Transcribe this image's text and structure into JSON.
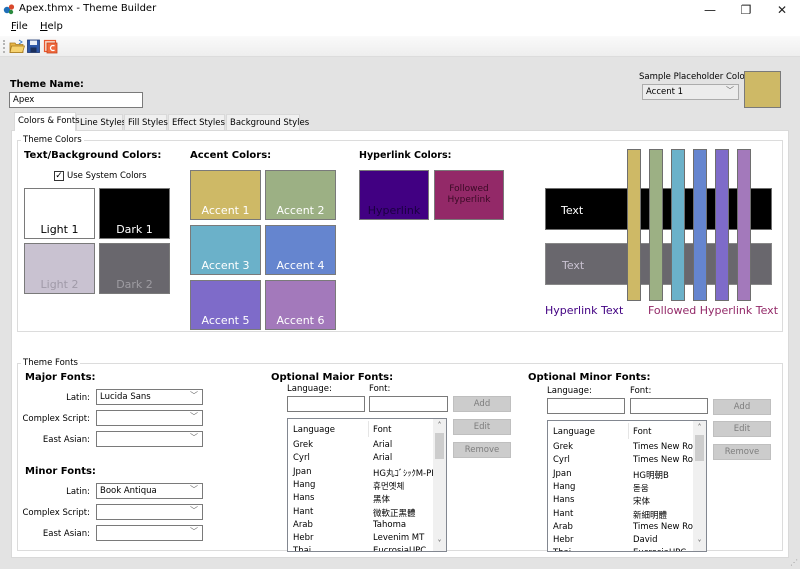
{
  "window": {
    "title": "Apex.thmx - Theme Builder",
    "minimize": "—",
    "restore": "❐",
    "close": "✕"
  },
  "menu": {
    "file": "File",
    "file_rest": "ile",
    "file_key": "F",
    "help_key": "H",
    "help_rest": "elp"
  },
  "toolbar": {
    "open": "open-folder-icon",
    "save": "save-disk-icon",
    "office": "office-theme-icon"
  },
  "theme_name": {
    "label": "Theme Name:",
    "value": "Apex"
  },
  "sample_placeholder": {
    "label": "Sample Placeholder Color:",
    "selected": "Accent 1",
    "swatch_color": "#ceb966"
  },
  "tabs": [
    {
      "label": "Colors & Fonts",
      "active": true
    },
    {
      "label": "Line Styles"
    },
    {
      "label": "Fill Styles"
    },
    {
      "label": "Effect Styles"
    },
    {
      "label": "Background Styles"
    }
  ],
  "theme_colors": {
    "legend": "Theme Colors",
    "text_bg_heading": "Text/Background Colors:",
    "use_system_colors_label": "Use System Colors",
    "use_system_colors_checked": true,
    "text_bg": [
      {
        "label": "Light 1",
        "color": "#ffffff",
        "text_color": "#000000"
      },
      {
        "label": "Dark 1",
        "color": "#000000",
        "text_color": "#ffffff"
      },
      {
        "label": "Light 2",
        "color": "#c9c2d1",
        "text_color": "#a09aa8"
      },
      {
        "label": "Dark 2",
        "color": "#69676d",
        "text_color": "#9e9ca2"
      }
    ],
    "accent_heading": "Accent Colors:",
    "accents": [
      {
        "label": "Accent 1",
        "color": "#ceb966"
      },
      {
        "label": "Accent 2",
        "color": "#9cb084"
      },
      {
        "label": "Accent 3",
        "color": "#6bb1c9"
      },
      {
        "label": "Accent 4",
        "color": "#6585cf"
      },
      {
        "label": "Accent 5",
        "color": "#7e6bc9"
      },
      {
        "label": "Accent 6",
        "color": "#a379bb"
      }
    ],
    "hyperlink_heading": "Hyperlink Colors:",
    "hyperlink": {
      "label": "Hyperlink",
      "color": "#410082"
    },
    "followed_hyperlink": {
      "label_line1": "Followed",
      "label_line2": "Hyperlink",
      "color": "#932968"
    },
    "preview": {
      "dark_text": "Text",
      "light_text": "Text",
      "hyperlink_text": "Hyperlink Text",
      "followed_text": "Followed Hyperlink Text"
    }
  },
  "theme_fonts": {
    "legend": "Theme Fonts",
    "major_heading": "Major Fonts:",
    "minor_heading": "Minor Fonts:",
    "latin_label": "Latin:",
    "complex_label": "Complex Script:",
    "east_asian_label": "East Asian:",
    "major": {
      "latin": "Lucida Sans",
      "complex": "",
      "east_asian": ""
    },
    "minor": {
      "latin": "Book Antiqua",
      "complex": "",
      "east_asian": ""
    },
    "optional_major": {
      "heading": "Optional Maior Fonts:",
      "language_label": "Language:",
      "font_label": "Font:",
      "language_value": "",
      "font_value": "",
      "add": "Add",
      "edit": "Edit",
      "remove": "Remove",
      "col_language": "Language",
      "col_font": "Font",
      "rows": [
        {
          "language": "Grek",
          "font": "Arial"
        },
        {
          "language": "Cyrl",
          "font": "Arial"
        },
        {
          "language": "Jpan",
          "font": "HG丸ｺﾞｼｯｸM-PRO"
        },
        {
          "language": "Hang",
          "font": "휴먼옛체"
        },
        {
          "language": "Hans",
          "font": "黑体"
        },
        {
          "language": "Hant",
          "font": "微軟正黑體"
        },
        {
          "language": "Arab",
          "font": "Tahoma"
        },
        {
          "language": "Hebr",
          "font": "Levenim MT"
        },
        {
          "language": "Thai",
          "font": "EucrosiaUPC"
        }
      ]
    },
    "optional_minor": {
      "heading": "Optional Minor Fonts:",
      "language_label": "Language:",
      "font_label": "Font:",
      "language_value": "",
      "font_value": "",
      "add": "Add",
      "edit": "Edit",
      "remove": "Remove",
      "col_language": "Language",
      "col_font": "Font",
      "rows": [
        {
          "language": "Grek",
          "font": "Times New Roman"
        },
        {
          "language": "Cyrl",
          "font": "Times New Roman"
        },
        {
          "language": "Jpan",
          "font": "HG明朝B"
        },
        {
          "language": "Hang",
          "font": "돋움"
        },
        {
          "language": "Hans",
          "font": "宋体"
        },
        {
          "language": "Hant",
          "font": "新細明體"
        },
        {
          "language": "Arab",
          "font": "Times New Roman"
        },
        {
          "language": "Hebr",
          "font": "David"
        },
        {
          "language": "Thai",
          "font": "EucrosiaUPC"
        }
      ]
    }
  }
}
